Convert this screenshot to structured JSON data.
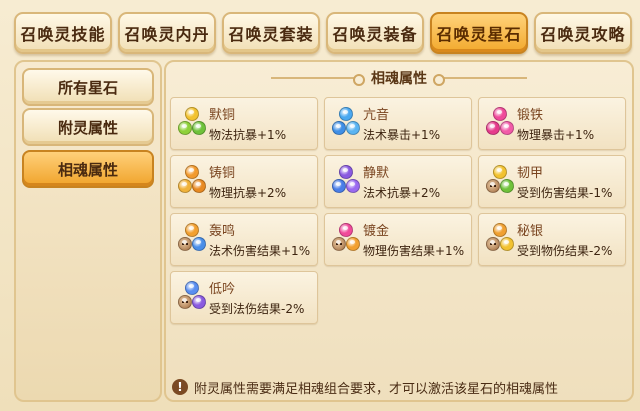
{
  "tabs": [
    {
      "label": "召唤灵技能",
      "active": false
    },
    {
      "label": "召唤灵内丹",
      "active": false
    },
    {
      "label": "召唤灵套装",
      "active": false
    },
    {
      "label": "召唤灵装备",
      "active": false
    },
    {
      "label": "召唤灵星石",
      "active": true
    },
    {
      "label": "召唤灵攻略",
      "active": false
    }
  ],
  "sidenav": [
    {
      "label": "所有星石",
      "active": false
    },
    {
      "label": "附灵属性",
      "active": false
    },
    {
      "label": "相魂属性",
      "active": true
    }
  ],
  "panel": {
    "title": "相魂属性",
    "footer_icon": "!",
    "footer_text": "附灵属性需要满足相魂组合要求，才可以激活该星石的相魂属性"
  },
  "cards": [
    {
      "name": "默铜",
      "desc": "物法抗暴+1%",
      "gems": [
        "#f2c230",
        "#8fd13a",
        "#6fc23a"
      ]
    },
    {
      "name": "亢音",
      "desc": "法术暴击+1%",
      "gems": [
        "#4aa8f0",
        "#3f8fe6",
        "#5ab4f2"
      ]
    },
    {
      "name": "锻铁",
      "desc": "物理暴击+1%",
      "gems": [
        "#f04a9a",
        "#e63c8c",
        "#f25aa8"
      ]
    },
    {
      "name": "铸铜",
      "desc": "物理抗暴+2%",
      "gems": [
        "#f29a2e",
        "#f0b23a",
        "#e88a22"
      ]
    },
    {
      "name": "静默",
      "desc": "法术抗暴+2%",
      "gems": [
        "#8a5ae0",
        "#4a7ee8",
        "#9a6af0"
      ]
    },
    {
      "name": "韧甲",
      "desc": "受到伤害结果-1%",
      "gems": [
        "#f2c230",
        "face",
        "#6fc23a"
      ]
    },
    {
      "name": "轰鸣",
      "desc": "法术伤害结果+1%",
      "gems": [
        "#f2a030",
        "face",
        "#4a8ee8"
      ]
    },
    {
      "name": "镀金",
      "desc": "物理伤害结果+1%",
      "gems": [
        "#f04a9a",
        "face",
        "#f2a030"
      ]
    },
    {
      "name": "秘银",
      "desc": "受到物伤结果-2%",
      "gems": [
        "#f0a030",
        "face",
        "#f2c230"
      ]
    },
    {
      "name": "低吟",
      "desc": "受到法伤结果-2%",
      "gems": [
        "#5a8ef0",
        "face",
        "#8a5ae0"
      ]
    }
  ]
}
